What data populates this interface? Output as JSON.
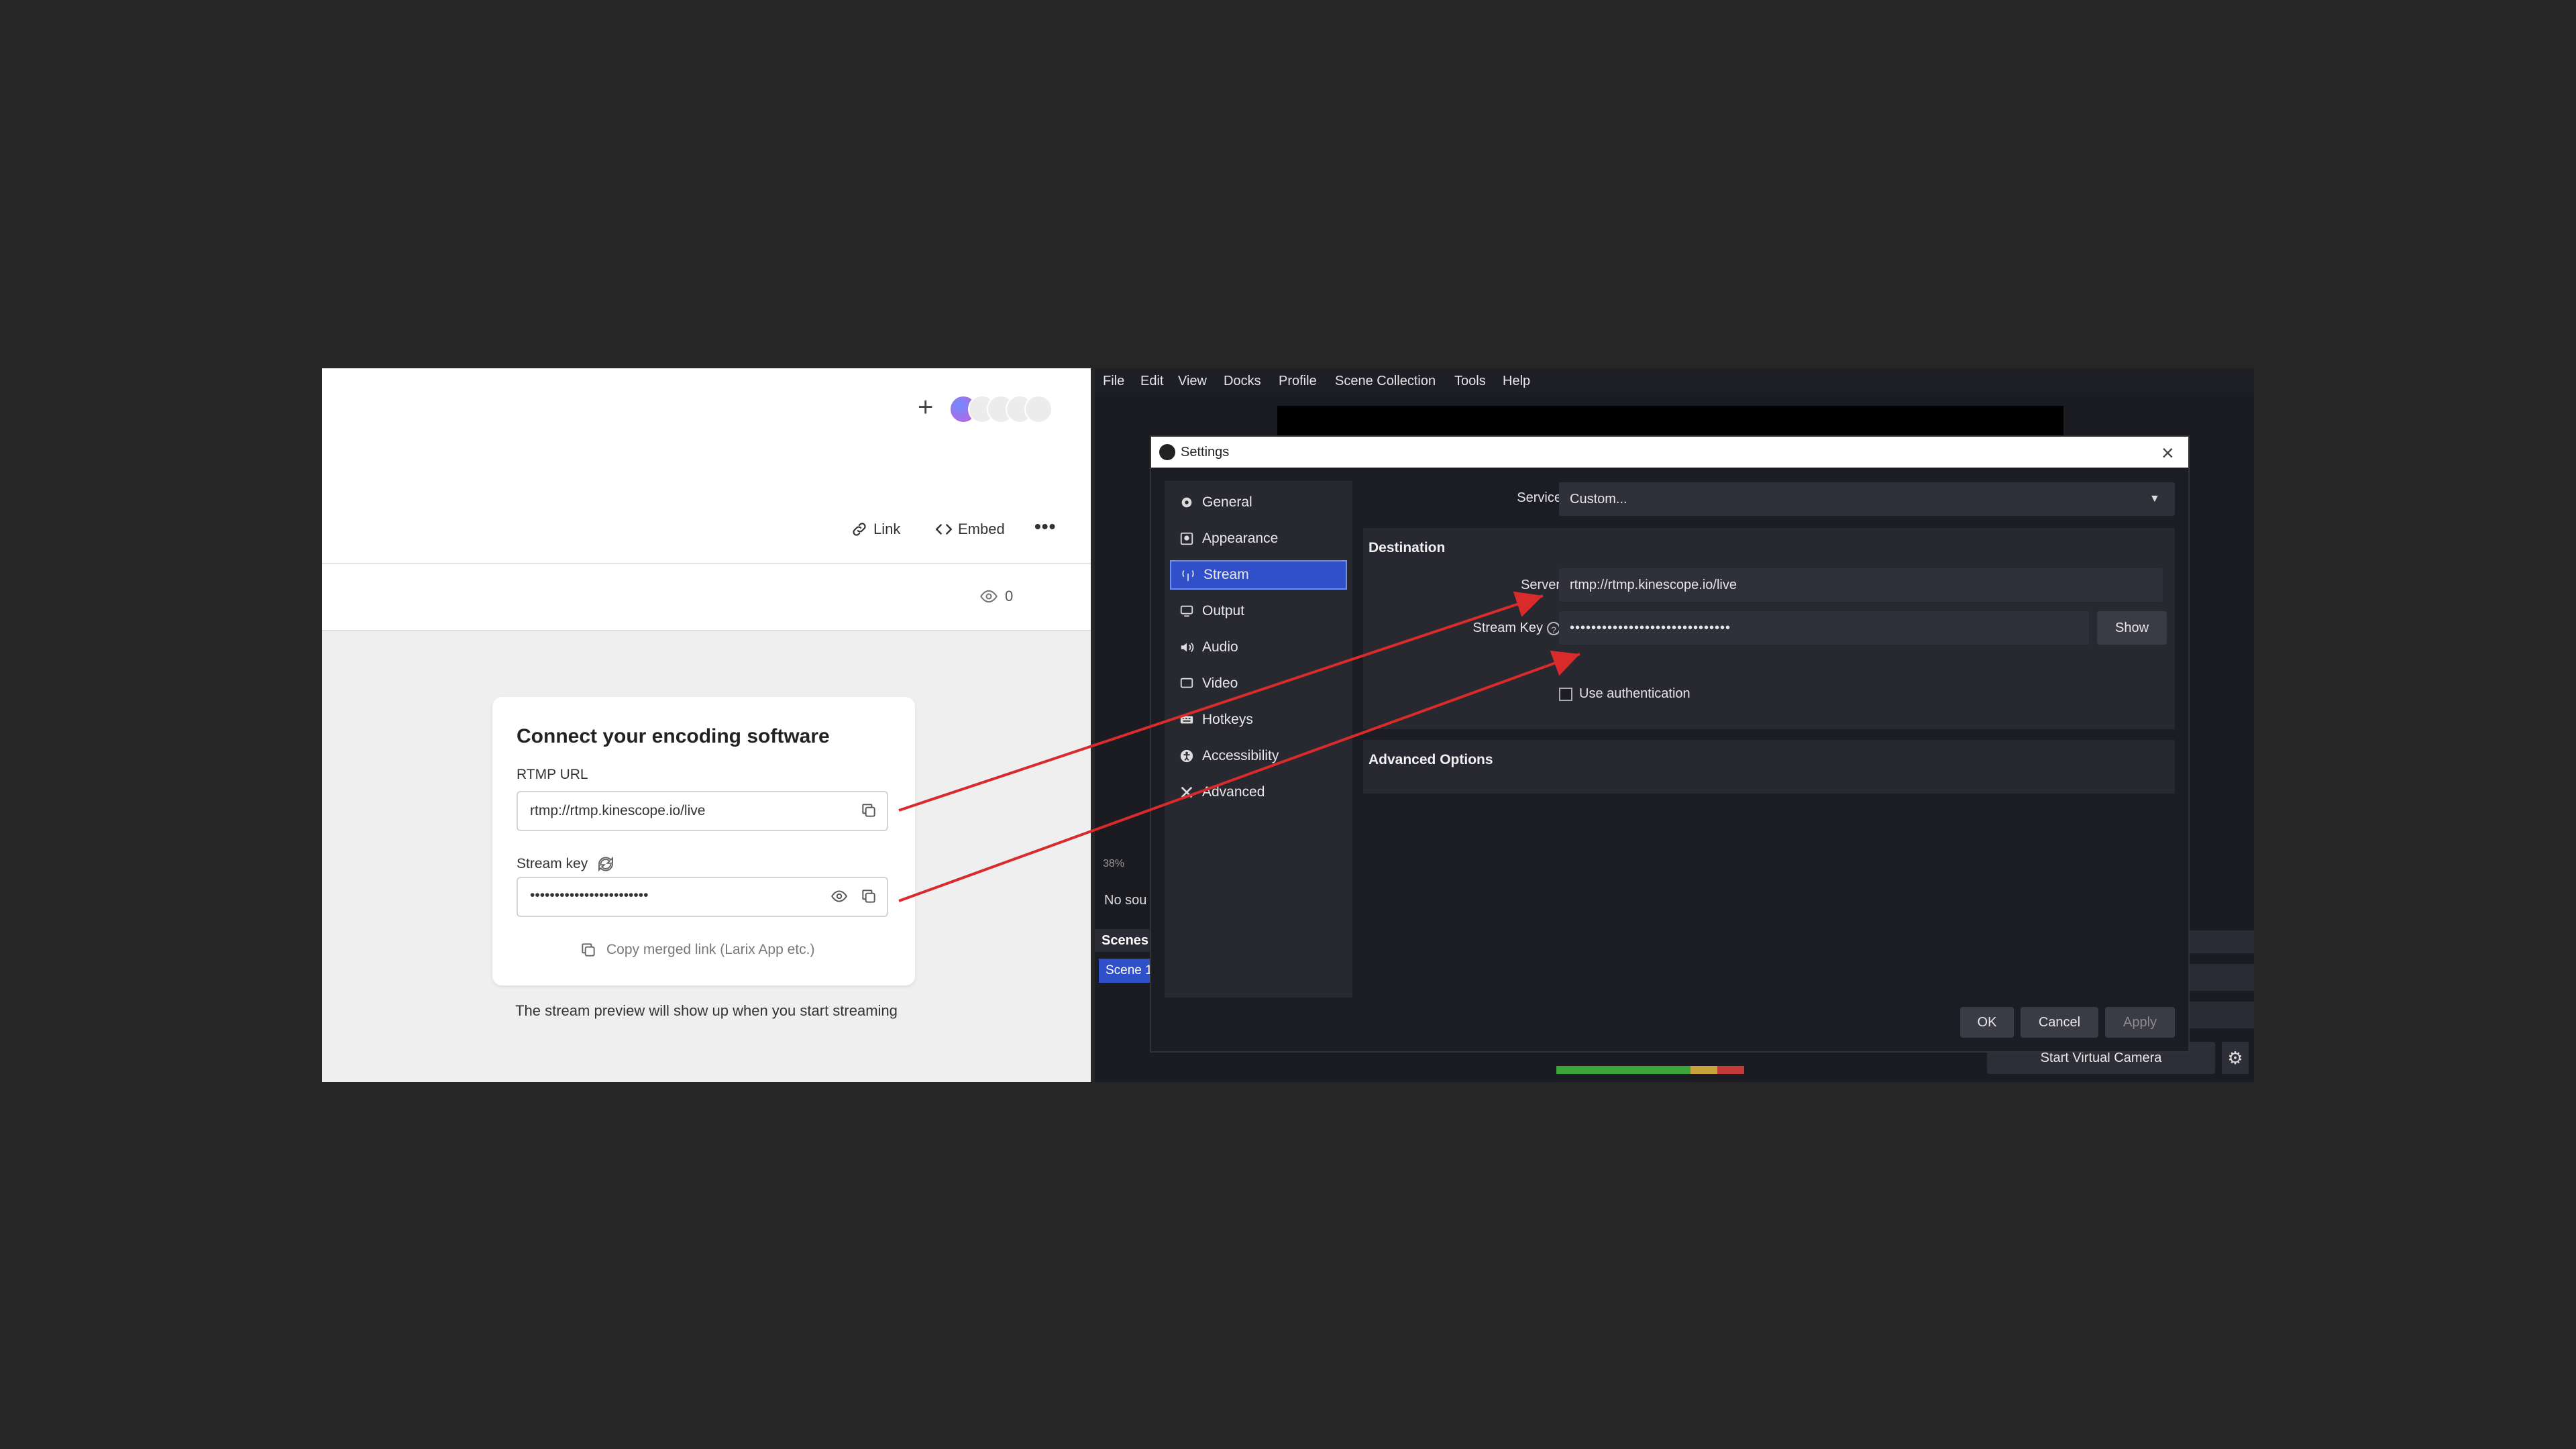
{
  "web": {
    "toolbar": {
      "link_label": "Link",
      "embed_label": "Embed",
      "more_label": "•••"
    },
    "views_count": "0",
    "card": {
      "title": "Connect your encoding software",
      "rtmp_label": "RTMP URL",
      "rtmp_value": "rtmp://rtmp.kinescope.io/live",
      "key_label": "Stream key",
      "key_value": "••••••••••••••••••••••••",
      "merged_label": "Copy merged link (Larix App etc.)"
    },
    "preview_note": "The stream preview will show up when you start streaming"
  },
  "obs": {
    "menu": [
      "File",
      "Edit",
      "View",
      "Docks",
      "Profile",
      "Scene Collection",
      "Tools",
      "Help"
    ],
    "no_source": "No sou",
    "zoom": "38%",
    "scenes_header": "Scenes",
    "scene_item": "Scene 1",
    "start_virtual_camera": "Start Virtual Camera"
  },
  "settings": {
    "title": "Settings",
    "sidebar": [
      {
        "label": "General",
        "icon": "gear-icon"
      },
      {
        "label": "Appearance",
        "icon": "appearance-icon"
      },
      {
        "label": "Stream",
        "icon": "antenna-icon"
      },
      {
        "label": "Output",
        "icon": "output-icon"
      },
      {
        "label": "Audio",
        "icon": "speaker-icon"
      },
      {
        "label": "Video",
        "icon": "monitor-icon"
      },
      {
        "label": "Hotkeys",
        "icon": "keyboard-icon"
      },
      {
        "label": "Accessibility",
        "icon": "accessibility-icon"
      },
      {
        "label": "Advanced",
        "icon": "tools-icon"
      }
    ],
    "service_label": "Service",
    "service_value": "Custom...",
    "destination_title": "Destination",
    "server_label": "Server",
    "server_value": "rtmp://rtmp.kinescope.io/live",
    "key_label": "Stream Key",
    "key_value": "••••••••••••••••••••••••••••••",
    "show_label": "Show",
    "auth_label": "Use authentication",
    "advanced_title": "Advanced Options",
    "ok_label": "OK",
    "cancel_label": "Cancel",
    "apply_label": "Apply"
  },
  "colors": {
    "accent": "#2f50c8",
    "arrow": "#d92b2b"
  }
}
